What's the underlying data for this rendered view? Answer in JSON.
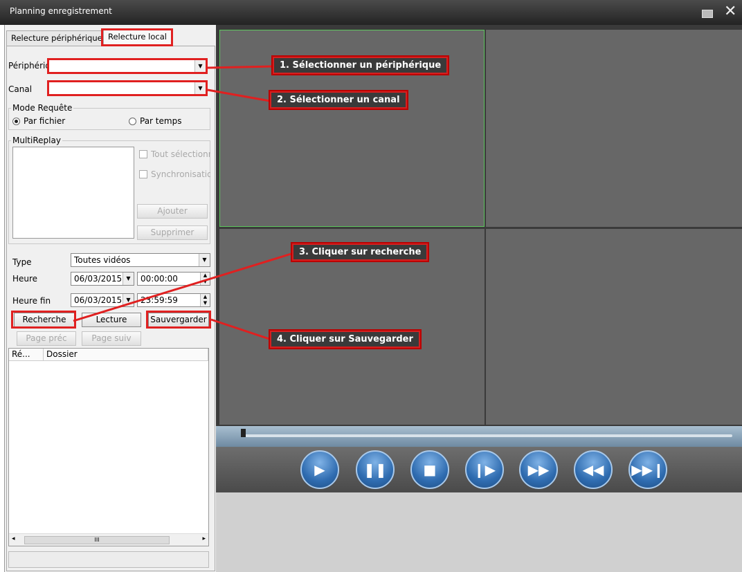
{
  "window": {
    "title": "Planning enregistrement"
  },
  "tabs": {
    "device": "Relecture périphérique",
    "local": "Relecture local"
  },
  "form": {
    "device_label": "Périphérique",
    "channel_label": "Canal",
    "mode_group": "Mode Requête",
    "by_file": "Par fichier",
    "by_time": "Par temps",
    "multireplay_group": "MultiReplay",
    "select_all": "Tout sélectionn",
    "sync": "Synchronisatio",
    "add": "Ajouter",
    "remove": "Supprimer",
    "type_label": "Type",
    "type_value": "Toutes vidéos",
    "start_label": "Heure",
    "start_date": "06/03/2015",
    "start_time": "00:00:00",
    "end_label": "Heure fin",
    "end_date": "06/03/2015",
    "end_time": "23:59:59"
  },
  "actions": {
    "search": "Recherche",
    "play": "Lecture",
    "save": "Sauvergarder",
    "prev_page": "Page préc",
    "next_page": "Page suiv"
  },
  "results": {
    "col1": "Ré...",
    "col2": "Dossier",
    "scroll_mid": "III"
  },
  "annotations": {
    "step1": "1. Sélectionner un périphérique",
    "step2": "2. Sélectionner un canal",
    "step3": "3. Cliquer sur recherche",
    "step4": "4. Cliquer sur Sauvegarder"
  },
  "controls": [
    "play-icon",
    "pause-icon",
    "stop-icon",
    "step-forward-icon",
    "fast-forward-icon",
    "rewind-icon",
    "skip-end-icon"
  ],
  "colors": {
    "annotation_red": "#e02020",
    "video_cell": "#676767",
    "control_blue": "#2f6cb0"
  }
}
